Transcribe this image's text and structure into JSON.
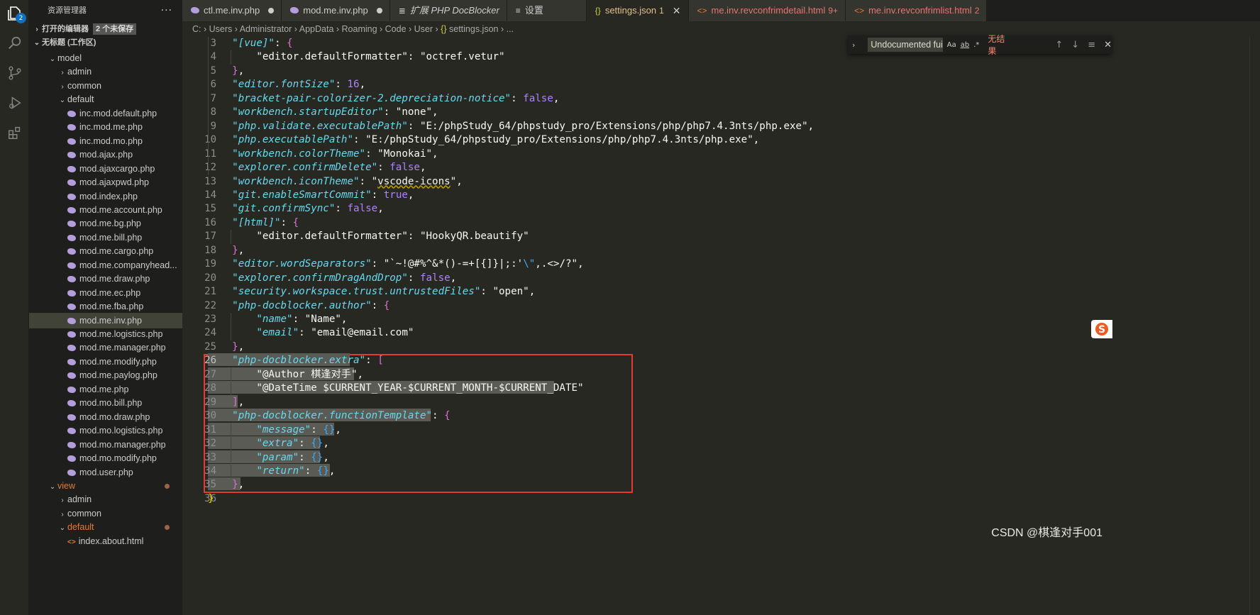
{
  "activity_bar": {
    "badge": "2",
    "icons": [
      "explorer-icon",
      "search-icon",
      "source-control-icon",
      "run-debug-icon",
      "extensions-icon"
    ]
  },
  "sidebar": {
    "title": "资源管理器",
    "more": "···",
    "open_editors": "打开的编辑器",
    "unsaved": "2 个未保存",
    "workspace": "无标题 (工作区)",
    "items": [
      {
        "label": "model",
        "type": "folder-open",
        "indent": 2
      },
      {
        "label": "admin",
        "type": "folder",
        "indent": 3
      },
      {
        "label": "common",
        "type": "folder",
        "indent": 3
      },
      {
        "label": "default",
        "type": "folder-open",
        "indent": 3
      },
      {
        "label": "inc.mod.default.php",
        "type": "php",
        "indent": 4
      },
      {
        "label": "inc.mod.me.php",
        "type": "php",
        "indent": 4
      },
      {
        "label": "inc.mod.mo.php",
        "type": "php",
        "indent": 4
      },
      {
        "label": "mod.ajax.php",
        "type": "php",
        "indent": 4
      },
      {
        "label": "mod.ajaxcargo.php",
        "type": "php",
        "indent": 4
      },
      {
        "label": "mod.ajaxpwd.php",
        "type": "php",
        "indent": 4
      },
      {
        "label": "mod.index.php",
        "type": "php",
        "indent": 4
      },
      {
        "label": "mod.me.account.php",
        "type": "php",
        "indent": 4
      },
      {
        "label": "mod.me.bg.php",
        "type": "php",
        "indent": 4
      },
      {
        "label": "mod.me.bill.php",
        "type": "php",
        "indent": 4
      },
      {
        "label": "mod.me.cargo.php",
        "type": "php",
        "indent": 4
      },
      {
        "label": "mod.me.companyhead...",
        "type": "php",
        "indent": 4
      },
      {
        "label": "mod.me.draw.php",
        "type": "php",
        "indent": 4
      },
      {
        "label": "mod.me.ec.php",
        "type": "php",
        "indent": 4
      },
      {
        "label": "mod.me.fba.php",
        "type": "php",
        "indent": 4
      },
      {
        "label": "mod.me.inv.php",
        "type": "php",
        "indent": 4,
        "selected": true
      },
      {
        "label": "mod.me.logistics.php",
        "type": "php",
        "indent": 4
      },
      {
        "label": "mod.me.manager.php",
        "type": "php",
        "indent": 4
      },
      {
        "label": "mod.me.modify.php",
        "type": "php",
        "indent": 4
      },
      {
        "label": "mod.me.paylog.php",
        "type": "php",
        "indent": 4
      },
      {
        "label": "mod.me.php",
        "type": "php",
        "indent": 4
      },
      {
        "label": "mod.mo.bill.php",
        "type": "php",
        "indent": 4
      },
      {
        "label": "mod.mo.draw.php",
        "type": "php",
        "indent": 4
      },
      {
        "label": "mod.mo.logistics.php",
        "type": "php",
        "indent": 4
      },
      {
        "label": "mod.mo.manager.php",
        "type": "php",
        "indent": 4
      },
      {
        "label": "mod.mo.modify.php",
        "type": "php",
        "indent": 4
      },
      {
        "label": "mod.user.php",
        "type": "php",
        "indent": 4
      },
      {
        "label": "view",
        "type": "folder-open",
        "indent": 2,
        "modified": true
      },
      {
        "label": "admin",
        "type": "folder",
        "indent": 3
      },
      {
        "label": "common",
        "type": "folder",
        "indent": 3
      },
      {
        "label": "default",
        "type": "folder-open",
        "indent": 3,
        "modified": true
      },
      {
        "label": "index.about.html",
        "type": "html",
        "indent": 4
      }
    ]
  },
  "tabs": [
    {
      "label": "ctl.me.inv.php",
      "icon": "php",
      "modified": true
    },
    {
      "label": "mod.me.inv.php",
      "icon": "php",
      "modified": true
    },
    {
      "label": "扩展 PHP DocBlocker",
      "icon": "extension",
      "italic": true
    },
    {
      "label": "设置",
      "icon": "settings"
    },
    {
      "label": "settings.json",
      "icon": "json",
      "count": "1",
      "active": true
    },
    {
      "label": "me.inv.revconfrimdetail.html",
      "icon": "html",
      "count": "9+"
    },
    {
      "label": "me.inv.revconfrimlist.html",
      "icon": "html",
      "count": "2"
    }
  ],
  "breadcrumb": {
    "parts": [
      "C:",
      "Users",
      "Administrator",
      "AppData",
      "Roaming",
      "Code",
      "User"
    ],
    "file": "settings.json",
    "tail": "..."
  },
  "find_widget": {
    "query": "Undocumented fui",
    "case": "Aa",
    "word": "ab",
    "regex": ".*",
    "result": "无结果"
  },
  "editor": {
    "lines": [
      {
        "n": "3",
        "html": "    <span class='k'>\"[vue]\"</span>: <span class='p'>{</span>"
      },
      {
        "n": "4",
        "html": "        <span class='w'>\"editor.defaultFormatter\"</span>: \"octref.vetur\""
      },
      {
        "n": "5",
        "html": "    <span class='p'>}</span>,"
      },
      {
        "n": "6",
        "html": "    <span class='k'>\"editor.fontSize\"</span>: <span class='b'>16</span>,"
      },
      {
        "n": "7",
        "html": "    <span class='k'>\"bracket-pair-colorizer-2.depreciation-notice\"</span>: <span class='b'>false</span>,"
      },
      {
        "n": "8",
        "html": "    <span class='k'>\"workbench.startupEditor\"</span>: \"none\","
      },
      {
        "n": "9",
        "html": "    <span class='k'>\"php.validate.executablePath\"</span>: \"E:/phpStudy_64/phpstudy_pro/Extensions/php/php7.4.3nts/php.exe\","
      },
      {
        "n": "10",
        "html": "    <span class='k'>\"php.executablePath\"</span>: \"E:/phpStudy_64/phpstudy_pro/Extensions/php/php7.4.3nts/php.exe\","
      },
      {
        "n": "11",
        "html": "    <span class='k'>\"workbench.colorTheme\"</span>: \"Monokai\","
      },
      {
        "n": "12",
        "html": "    <span class='k'>\"explorer.confirmDelete\"</span>: <span class='b'>false</span>,"
      },
      {
        "n": "13",
        "html": "    <span class='k'>\"workbench.iconTheme\"</span>: \"<span style='text-decoration:underline wavy #c9a600'>vscode-icons</span>\","
      },
      {
        "n": "14",
        "html": "    <span class='k'>\"git.enableSmartCommit\"</span>: <span class='b'>true</span>,"
      },
      {
        "n": "15",
        "html": "    <span class='k'>\"git.confirmSync\"</span>: <span class='b'>false</span>,"
      },
      {
        "n": "16",
        "html": "    <span class='k'>\"[html]\"</span>: <span class='p'>{</span>"
      },
      {
        "n": "17",
        "html": "        <span class='w'>\"editor.defaultFormatter\"</span>: \"HookyQR.beautify\""
      },
      {
        "n": "18",
        "html": "    <span class='p'>}</span>,"
      },
      {
        "n": "19",
        "html": "    <span class='k'>\"editor.wordSeparators\"</span>: \"`~!@#%^&amp;*()-=+[{]}|;:'<span class='g'>\\\"</span>,.&lt;&gt;/?\","
      },
      {
        "n": "20",
        "html": "    <span class='k'>\"explorer.confirmDragAndDrop\"</span>: <span class='b'>false</span>,"
      },
      {
        "n": "21",
        "html": "    <span class='k'>\"security.workspace.trust.untrustedFiles\"</span>: \"open\","
      },
      {
        "n": "22",
        "html": "    <span class='k'>\"php-docblocker.author\"</span>: <span class='p'>{</span>"
      },
      {
        "n": "23",
        "html": "        <span class='k'>\"name\"</span>: \"Name\","
      },
      {
        "n": "24",
        "html": "        <span class='k'>\"email\"</span>: \"email@email.com\""
      },
      {
        "n": "25",
        "html": "    <span class='p'>}</span>,"
      },
      {
        "n": "26",
        "html": "    <span class='k'>\"php-docblocker.extra\"</span>: <span class='p'>[</span>"
      },
      {
        "n": "27",
        "html": "        \"@Author 棋逢对手\","
      },
      {
        "n": "28",
        "html": "        \"@DateTime $CURRENT_YEAR-$CURRENT_MONTH-$CURRENT_DATE\""
      },
      {
        "n": "29",
        "html": "    <span class='p'>]</span>,"
      },
      {
        "n": "30",
        "html": "    <span class='k'>\"php-docblocker.functionTemplate\"</span>: <span class='p'>{</span>"
      },
      {
        "n": "31",
        "html": "        <span class='k'>\"message\"</span>: <span class='g'>{}</span>,"
      },
      {
        "n": "32",
        "html": "        <span class='k'>\"extra\"</span>: <span class='g'>{}</span>,"
      },
      {
        "n": "33",
        "html": "        <span class='k'>\"param\"</span>: <span class='g'>{}</span>,"
      },
      {
        "n": "34",
        "html": "        <span class='k'>\"return\"</span>: <span class='g'>{}</span>,"
      },
      {
        "n": "35",
        "html": "    <span class='p'>}</span>,"
      },
      {
        "n": "36",
        "html": "<span class='y'>}</span>"
      }
    ]
  },
  "watermark": "CSDN @棋逢对手001",
  "colors": {
    "accent": "#0e70c0",
    "highlight_box": "#e53935",
    "tab_active_text": "#e2c08d"
  }
}
